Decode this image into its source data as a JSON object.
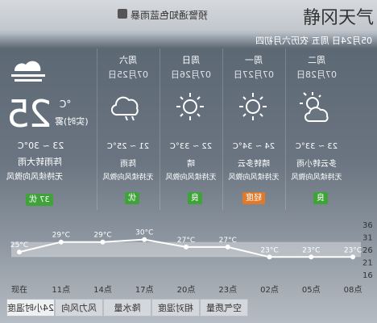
{
  "page_title": "静冈天气",
  "notice": "预警通知色蓝雨暴",
  "header_date": "05月24日 周五 农历六月初四",
  "today": {
    "temp": "25",
    "unit": "°C",
    "realtime": "(实时)雾",
    "range": "23 ~ 30°C",
    "condition": "阵雨转大雨",
    "wind": "无持续风向微风",
    "aqi": "37 优"
  },
  "days": [
    {
      "name": "周六",
      "date": "07月25日",
      "icon": "cloud-rain-icon",
      "range": "21 ~ 25°C",
      "cond": "阵雨",
      "wind": "无持续风向微风",
      "aqi": "优",
      "aqi_level": "good"
    },
    {
      "name": "周日",
      "date": "07月26日",
      "icon": "sun-icon",
      "range": "22 ~ 33°C",
      "cond": "晴",
      "wind": "无持续风向微风",
      "aqi": "良",
      "aqi_level": "good"
    },
    {
      "name": "周一",
      "date": "07月27日",
      "icon": "sun-icon",
      "range": "24 ~ 34°C",
      "cond": "晴转多云",
      "wind": "无持续风向微风",
      "aqi": "轻度",
      "aqi_level": "light"
    },
    {
      "name": "周二",
      "date": "07月28日",
      "icon": "sun-cloud-icon",
      "range": "23 ~ 33°C",
      "cond": "多云转小雨",
      "wind": "无持续风向微风",
      "aqi": "良",
      "aqi_level": "good"
    }
  ],
  "chart_data": {
    "type": "line",
    "categories": [
      "现在",
      "11点",
      "14点",
      "17点",
      "20点",
      "23点",
      "02点",
      "05点",
      "08点"
    ],
    "values": [
      25,
      29,
      29,
      30,
      27,
      27,
      23,
      23,
      23
    ],
    "labels": [
      "25°C",
      "29°C",
      "29°C",
      "30°C",
      "27°C",
      "27°C",
      "23°C",
      "23°C",
      "23°C"
    ],
    "y_ticks": [
      "36",
      "31",
      "26",
      "21",
      "16"
    ],
    "ylim": [
      16,
      36
    ]
  },
  "tabs": [
    "24小时温度",
    "风力风向",
    "降水量",
    "相对湿度",
    "空气质量"
  ],
  "colors": {
    "good": "#3fa33a",
    "light": "#e07a2a"
  }
}
